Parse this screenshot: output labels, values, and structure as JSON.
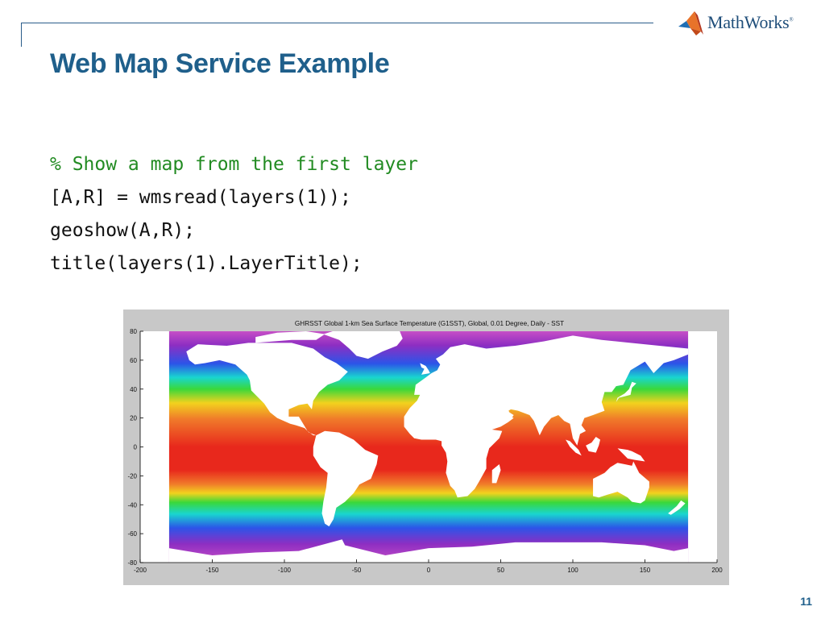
{
  "logo": {
    "text": "MathWorks",
    "mark": "®",
    "icon": "membrane-icon"
  },
  "slide": {
    "title": "Web Map Service Example",
    "page_number": "11"
  },
  "code": {
    "comment": "% Show a map from the first layer",
    "lines": [
      "[A,R] = wmsread(layers(1));",
      "geoshow(A,R);",
      "title(layers(1).LayerTitle);"
    ]
  },
  "figure": {
    "title": "GHRSST Global 1-km Sea Surface Temperature (G1SST), Global, 0.01 Degree, Daily - SST",
    "xticks": [
      "-200",
      "-150",
      "-100",
      "-50",
      "0",
      "50",
      "100",
      "150",
      "200"
    ],
    "yticks": [
      "80",
      "60",
      "40",
      "20",
      "0",
      "-20",
      "-40",
      "-60",
      "-80"
    ],
    "xlim": [
      -200,
      200
    ],
    "ylim": [
      -80,
      80
    ],
    "map_extent": {
      "lon": [
        -180,
        180
      ],
      "lat": [
        -80,
        80
      ]
    },
    "colors": {
      "tropical": "#e8281c",
      "warm": "#f07a2a",
      "mild": "#f2d21e",
      "temperate": "#3ad83a",
      "cool": "#19d6cf",
      "cold": "#2c54e8",
      "polar": "#8e2ec2",
      "ice": "#c64fc6",
      "land": "#ffffff"
    }
  }
}
